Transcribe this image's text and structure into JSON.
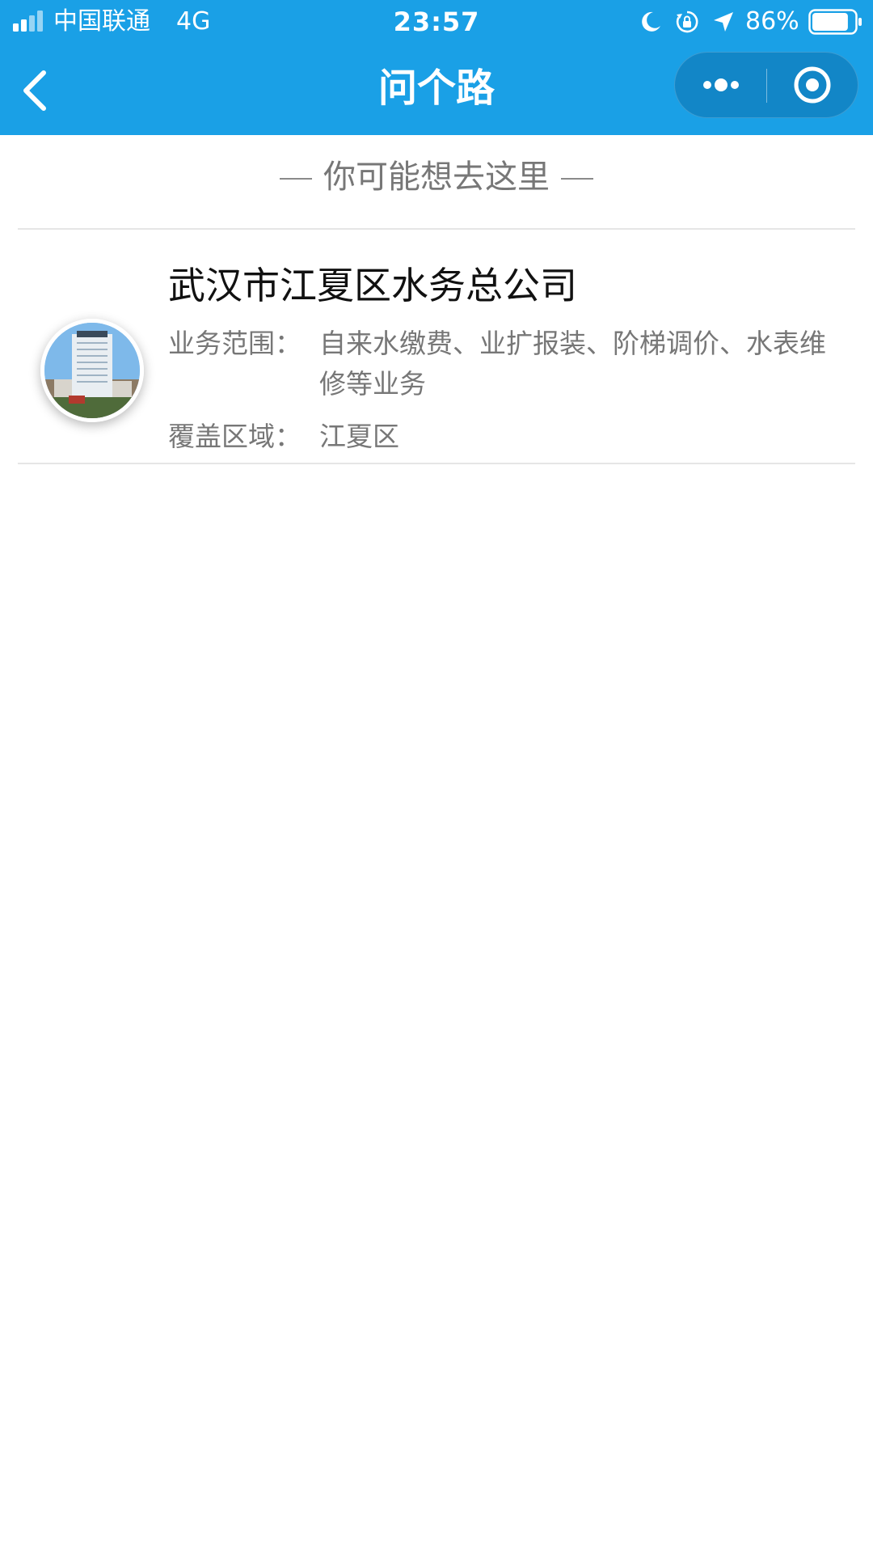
{
  "status_bar": {
    "carrier": "中国联通",
    "network": "4G",
    "time": "23:57",
    "battery_percent": "86%",
    "battery_level": 0.86,
    "icons": [
      "signal-icon",
      "moon-icon",
      "rotation-lock-icon",
      "location-arrow-icon",
      "battery-icon"
    ]
  },
  "nav": {
    "title": "问个路",
    "back_icon": "chevron-left-icon",
    "more_icon": "more-dots-icon",
    "close_icon": "target-circle-icon"
  },
  "section": {
    "heading": "你可能想去这里"
  },
  "result": {
    "name": "武汉市江夏区水务总公司",
    "fields": [
      {
        "label": "业务范围：",
        "value": "自来水缴费、业扩报装、阶梯调价、水表维修等业务"
      },
      {
        "label": "覆盖区域：",
        "value": "江夏区"
      }
    ]
  },
  "colors": {
    "brand": "#1aa0e6",
    "text_primary": "#111111",
    "text_secondary": "#777777",
    "divider": "#e6e6e6"
  }
}
